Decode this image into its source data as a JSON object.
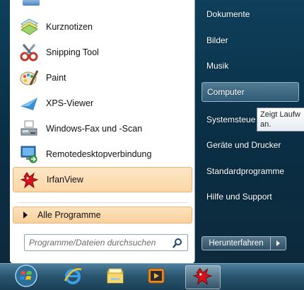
{
  "programs": [
    {
      "label": "Kurznotizen",
      "icon": "sticky-notes-icon"
    },
    {
      "label": "Snipping Tool",
      "icon": "scissors-icon"
    },
    {
      "label": "Paint",
      "icon": "paint-palette-icon"
    },
    {
      "label": "XPS-Viewer",
      "icon": "xps-viewer-icon"
    },
    {
      "label": "Windows-Fax und -Scan",
      "icon": "fax-icon"
    },
    {
      "label": "Remotedesktopverbindung",
      "icon": "remote-desktop-icon"
    },
    {
      "label": "IrfanView",
      "icon": "irfanview-icon"
    }
  ],
  "all_programs": {
    "label": "Alle Programme"
  },
  "search": {
    "placeholder": "Programme/Dateien durchsuchen"
  },
  "right_pane": {
    "links": [
      {
        "label": "Dokumente"
      },
      {
        "label": "Bilder"
      },
      {
        "label": "Musik"
      },
      {
        "label": "Computer"
      },
      {
        "label": "Systemsteue"
      },
      {
        "label": "Geräte und Drucker"
      },
      {
        "label": "Standardprogramme"
      },
      {
        "label": "Hilfe und Support"
      }
    ],
    "tooltip": {
      "line1": "Zeigt Laufw",
      "line2": "an."
    }
  },
  "shutdown": {
    "label": "Herunterfahren"
  },
  "taskbar": {
    "items": [
      {
        "name": "start-orb-icon"
      },
      {
        "name": "internet-explorer-icon"
      },
      {
        "name": "explorer-folder-icon"
      },
      {
        "name": "media-player-icon"
      },
      {
        "name": "irfanview-icon"
      }
    ]
  },
  "colors": {
    "highlight": "#fbd7a6",
    "menu_dark": "#0e3f5b",
    "taskbar": "#2a5671"
  }
}
